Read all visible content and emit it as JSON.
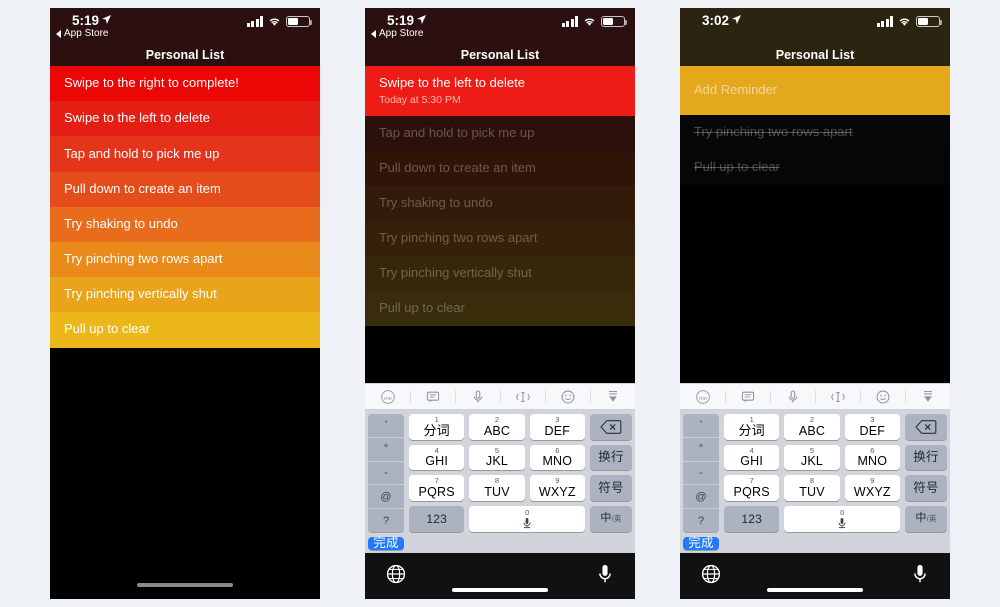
{
  "panels": [
    {
      "id": "panel-1",
      "status": {
        "time": "5:19",
        "back_label": "App Store",
        "location_icon": "location-arrow-icon",
        "signal_icon": "cellular-signal-icon",
        "wifi_icon": "wifi-icon",
        "battery_icon": "battery-icon"
      },
      "nav_title": "Personal List",
      "rows": [
        {
          "text": "Swipe to the right to complete!",
          "color": "#ec0707",
          "state": "normal"
        },
        {
          "text": "Swipe to the left to delete",
          "color": "#e41e13",
          "state": "normal"
        },
        {
          "text": "Tap and hold to pick me up",
          "color": "#e4351a",
          "state": "normal"
        },
        {
          "text": "Pull down to create an item",
          "color": "#e54c1b",
          "state": "normal"
        },
        {
          "text": "Try shaking to undo",
          "color": "#e86c1c",
          "state": "normal"
        },
        {
          "text": "Try pinching two rows apart",
          "color": "#ea8a1b",
          "state": "normal"
        },
        {
          "text": "Try pinching vertically shut",
          "color": "#eaa41a",
          "state": "normal"
        },
        {
          "text": "Pull up to clear",
          "color": "#ecb71b",
          "state": "normal"
        }
      ],
      "has_keyboard": false
    },
    {
      "id": "panel-2",
      "status": {
        "time": "5:19",
        "back_label": "App Store",
        "location_icon": "location-arrow-icon",
        "signal_icon": "cellular-signal-icon",
        "wifi_icon": "wifi-icon",
        "battery_icon": "battery-icon"
      },
      "nav_title": "Personal List",
      "active_row": {
        "text": "Swipe to the left to delete",
        "subtitle": "Today at 5:30 PM",
        "color": "#ed1c16"
      },
      "rows": [
        {
          "text": "Tap and hold to pick me up",
          "color": "#2c100c",
          "state": "dim"
        },
        {
          "text": "Pull down to create an item",
          "color": "#301409",
          "state": "dim"
        },
        {
          "text": "Try shaking to undo",
          "color": "#331b09",
          "state": "dim"
        },
        {
          "text": "Try pinching two rows apart",
          "color": "#352008",
          "state": "dim"
        },
        {
          "text": "Try pinching vertically shut",
          "color": "#37270a",
          "state": "dim"
        },
        {
          "text": "Pull up to clear",
          "color": "#392c0a",
          "state": "dim"
        }
      ],
      "has_keyboard": true
    },
    {
      "id": "panel-3",
      "status": {
        "time": "3:02",
        "back_label": "",
        "location_icon": "location-arrow-icon",
        "signal_icon": "cellular-signal-icon",
        "wifi_icon": "wifi-icon",
        "battery_icon": "battery-icon"
      },
      "nav_title": "Personal List",
      "active_row": {
        "text": "Add Reminder",
        "subtitle": "",
        "color": "#e3a81b"
      },
      "rows": [
        {
          "text": "Try pinching two rows apart",
          "color": "#070707",
          "state": "struck"
        },
        {
          "text": "Pull up to clear",
          "color": "#060606",
          "state": "struck"
        }
      ],
      "has_keyboard": true
    }
  ],
  "keyboard": {
    "toolbar_icons": [
      "memo-circle-icon",
      "chat-bubble-icon",
      "microphone-icon",
      "text-cursor-icon",
      "emoji-smiley-icon",
      "hide-keyboard-icon"
    ],
    "left_column": [
      "'",
      "°",
      "-",
      "@",
      "?"
    ],
    "keys": [
      {
        "num": "1",
        "label": "分词",
        "type": "cn"
      },
      {
        "num": "2",
        "label": "ABC",
        "type": "latin"
      },
      {
        "num": "3",
        "label": "DEF",
        "type": "latin"
      },
      {
        "num": "4",
        "label": "GHI",
        "type": "latin"
      },
      {
        "num": "5",
        "label": "JKL",
        "type": "latin"
      },
      {
        "num": "6",
        "label": "MNO",
        "type": "latin"
      },
      {
        "num": "7",
        "label": "PQRS",
        "type": "latin"
      },
      {
        "num": "8",
        "label": "TUV",
        "type": "latin"
      },
      {
        "num": "9",
        "label": "WXYZ",
        "type": "latin"
      }
    ],
    "delete_label": "delete-key-icon",
    "return_label": "换行",
    "symbols_label": "符号",
    "numbers_label": "123",
    "space_num": "0",
    "lang_main": "中",
    "lang_sub": "英",
    "done_label": "完成",
    "globe_icon": "globe-icon",
    "dictation_icon": "microphone-icon"
  },
  "colors": {
    "page_background": "#eef1f5",
    "keyboard_background": "#d1d4db",
    "key_white": "#ffffff",
    "key_gray": "#acb2bf",
    "done_blue": "#1f7bfb",
    "toolbar_background": "#f7f8fa"
  }
}
